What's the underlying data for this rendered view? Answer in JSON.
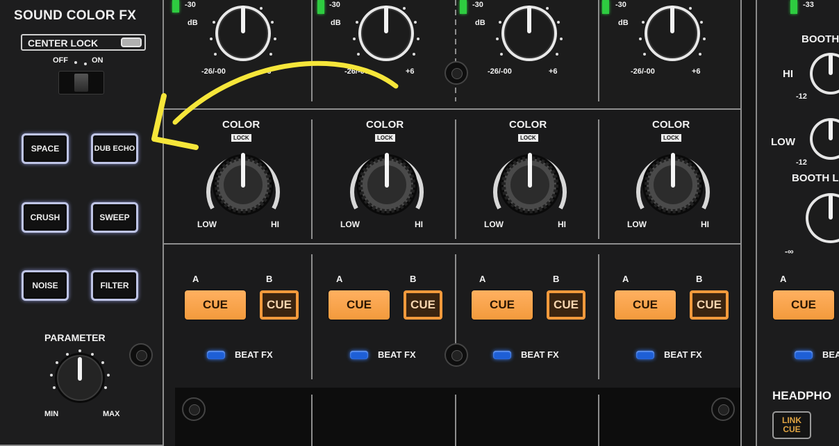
{
  "sound_color_fx": {
    "title": "SOUND COLOR FX",
    "center_lock_label": "CENTER LOCK",
    "toggle_off": "OFF",
    "toggle_on": "ON",
    "buttons": [
      "SPACE",
      "DUB ECHO",
      "CRUSH",
      "SWEEP",
      "NOISE",
      "FILTER"
    ],
    "parameter_label": "PARAMETER",
    "param_min": "MIN",
    "param_max": "MAX"
  },
  "trim": {
    "meter_label": "-30",
    "db_label": "dB",
    "min_label": "-26/-00",
    "max_label": "+6"
  },
  "color": {
    "label": "COLOR",
    "lock_label": "LOCK",
    "low_label": "LOW",
    "hi_label": "HI"
  },
  "channels": [
    {
      "a_label": "A",
      "b_label": "B",
      "cue_a": "CUE",
      "cue_b": "CUE",
      "beat_fx": "BEAT FX"
    },
    {
      "a_label": "A",
      "b_label": "B",
      "cue_a": "CUE",
      "cue_b": "CUE",
      "beat_fx": "BEAT FX"
    },
    {
      "a_label": "A",
      "b_label": "B",
      "cue_a": "CUE",
      "cue_b": "CUE",
      "beat_fx": "BEAT FX"
    },
    {
      "a_label": "A",
      "b_label": "B",
      "cue_a": "CUE",
      "cue_b": "CUE",
      "beat_fx": "BEAT FX"
    }
  ],
  "right_panel": {
    "meter_label": "-33",
    "booth_label": "BOOTH",
    "hi_label": "HI",
    "low_label": "LOW",
    "minus12_a": "-12",
    "minus12_b": "-12",
    "booth_level_label": "BOOTH L",
    "minus_inf": "-∞",
    "a_label": "A",
    "cue_a": "CUE",
    "beat_fx_partial": "BEA",
    "headphones_label": "HEADPHO",
    "link_cue_line1": "LINK",
    "link_cue_line2": "CUE"
  },
  "colors": {
    "cue_orange": "#f39a3c",
    "beat_fx_led": "#1e5fd6",
    "fx_button_glow": "#bfc5e6",
    "meter_green": "#2ecc40",
    "annotation_arrow": "#f6e63a"
  },
  "annotation": {
    "icon": "yellow-curved-arrow-icon"
  }
}
